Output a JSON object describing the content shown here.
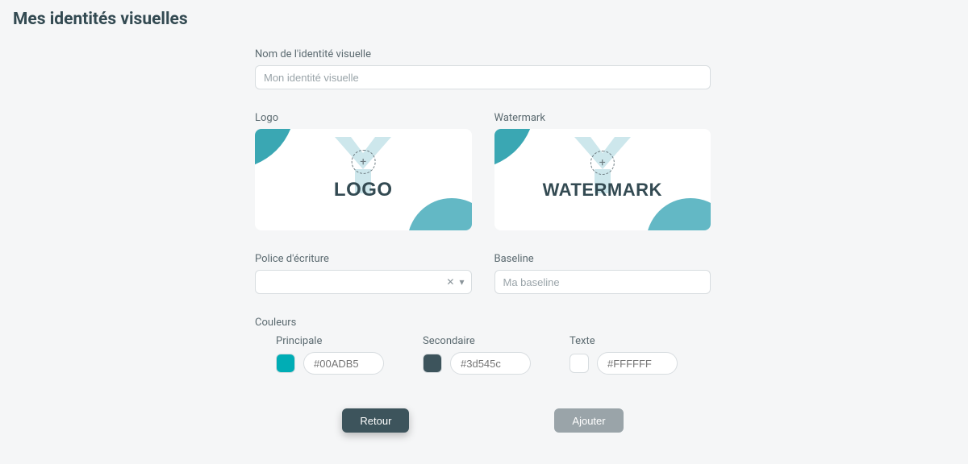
{
  "page": {
    "title": "Mes identités visuelles"
  },
  "form": {
    "name": {
      "label": "Nom de l'identité visuelle",
      "placeholder": "Mon identité visuelle",
      "value": ""
    },
    "logo": {
      "label": "Logo",
      "word": "LOGO"
    },
    "watermark": {
      "label": "Watermark",
      "word": "WATERMARK"
    },
    "font": {
      "label": "Police d'écriture",
      "value": ""
    },
    "baseline": {
      "label": "Baseline",
      "placeholder": "Ma baseline",
      "value": ""
    },
    "colors": {
      "label": "Couleurs",
      "primary": {
        "label": "Principale",
        "hex": "#00ADB5",
        "placeholder": "#00ADB5"
      },
      "secondary": {
        "label": "Secondaire",
        "hex": "#3d545c",
        "placeholder": "#3d545c"
      },
      "text": {
        "label": "Texte",
        "hex": "#FFFFFF",
        "placeholder": "#FFFFFF"
      }
    }
  },
  "buttons": {
    "back": "Retour",
    "add": "Ajouter"
  },
  "icons": {
    "plus": "+",
    "clear": "✕",
    "chevron": "▾"
  }
}
